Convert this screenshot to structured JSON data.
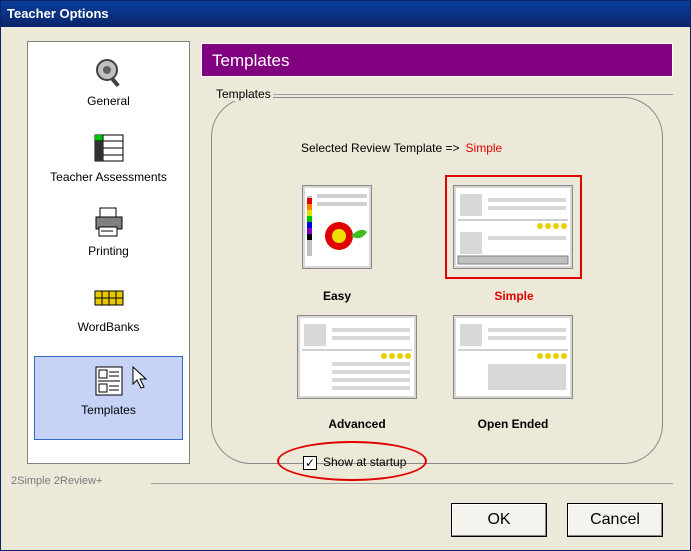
{
  "window": {
    "title": "Teacher Options"
  },
  "sidebar": {
    "items": [
      {
        "label": "General",
        "icon": "magnifier-icon"
      },
      {
        "label": "Teacher Assessments",
        "icon": "spreadsheet-icon"
      },
      {
        "label": "Printing",
        "icon": "printer-icon"
      },
      {
        "label": "WordBanks",
        "icon": "word-tiles-icon"
      },
      {
        "label": "Templates",
        "icon": "templates-icon",
        "selected": true
      }
    ]
  },
  "panel": {
    "header": "Templates",
    "group_label": "Templates",
    "selected_prefix": "Selected Review Template =>",
    "selected_value": "Simple",
    "templates": [
      {
        "label": "Easy"
      },
      {
        "label": "Simple",
        "selected": true
      },
      {
        "label": "Advanced"
      },
      {
        "label": "Open Ended"
      }
    ],
    "show_at_startup": {
      "label": "Show at startup",
      "checked": true
    }
  },
  "footer": {
    "product": "2Simple 2Review+",
    "ok_label": "OK",
    "cancel_label": "Cancel"
  },
  "colors": {
    "header_bg": "#800080",
    "selected_red": "#e00000",
    "titlebar": "#0a246a"
  }
}
